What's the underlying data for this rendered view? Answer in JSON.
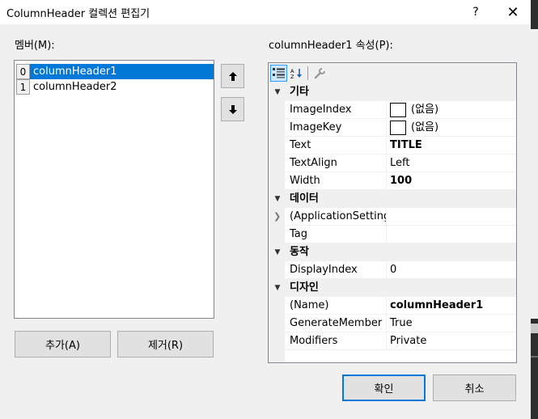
{
  "window": {
    "title": "ColumnHeader 컬렉션 편집기",
    "help_label": "?",
    "close_label": "✕"
  },
  "members": {
    "label": "멤버(M):",
    "items": [
      {
        "index": "0",
        "name": "columnHeader1",
        "selected": true
      },
      {
        "index": "1",
        "name": "columnHeader2",
        "selected": false
      }
    ],
    "up_label": "🡅",
    "down_label": "🡇"
  },
  "buttons": {
    "add": "추가(A)",
    "remove": "제거(R)",
    "ok": "확인",
    "cancel": "취소"
  },
  "properties": {
    "label": "columnHeader1 속성(P):",
    "categories": [
      {
        "name": "기타",
        "rows": [
          {
            "name": "ImageIndex",
            "value": "(없음)",
            "swatch": true
          },
          {
            "name": "ImageKey",
            "value": "(없음)",
            "swatch": true
          },
          {
            "name": "Text",
            "value": "TITLE",
            "bold": true
          },
          {
            "name": "TextAlign",
            "value": "Left"
          },
          {
            "name": "Width",
            "value": "100",
            "bold": true
          }
        ]
      },
      {
        "name": "데이터",
        "rows": [
          {
            "name": "(ApplicationSettings)",
            "value": "",
            "expandable": true
          },
          {
            "name": "Tag",
            "value": ""
          }
        ]
      },
      {
        "name": "동작",
        "rows": [
          {
            "name": "DisplayIndex",
            "value": "0"
          }
        ]
      },
      {
        "name": "디자인",
        "rows": [
          {
            "name": "(Name)",
            "value": "columnHeader1",
            "bold": true
          },
          {
            "name": "GenerateMember",
            "value": "True"
          },
          {
            "name": "Modifiers",
            "value": "Private"
          }
        ]
      }
    ]
  },
  "colors": {
    "selection": "#0078d7",
    "dialog_bg": "#f0f0f0"
  }
}
